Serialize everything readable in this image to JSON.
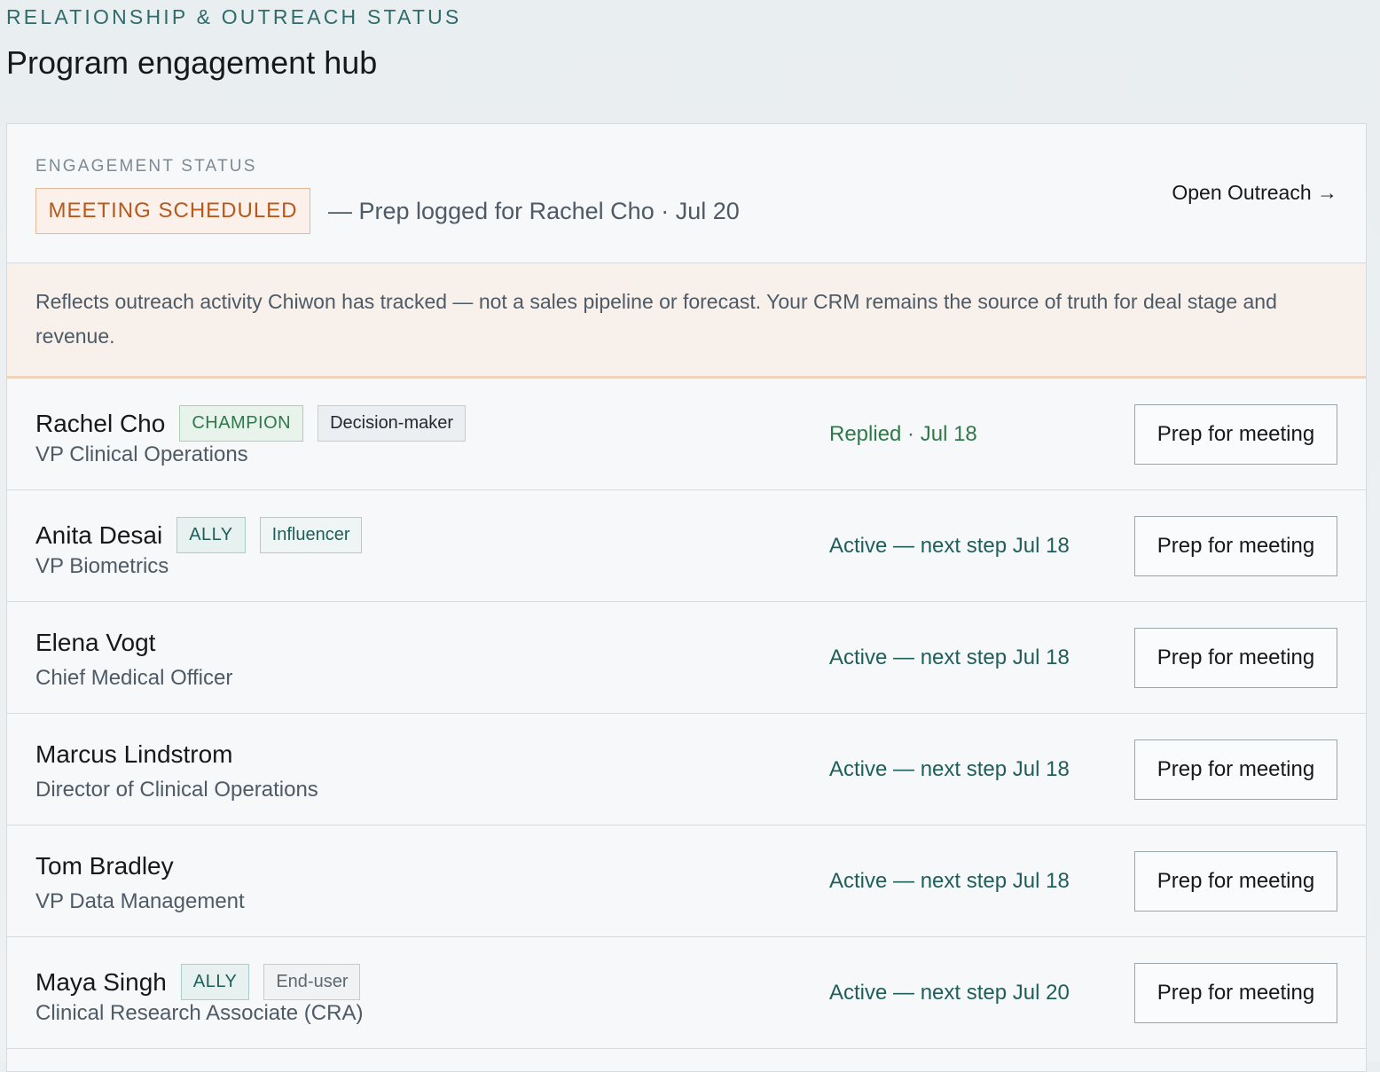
{
  "header": {
    "eyebrow": "RELATIONSHIP & OUTREACH STATUS",
    "title": "Program engagement hub"
  },
  "engagement": {
    "label": "ENGAGEMENT STATUS",
    "badge": "MEETING SCHEDULED",
    "detail": "— Prep logged for Rachel Cho · Jul 20",
    "open_link": "Open Outreach →"
  },
  "notice": "Reflects outreach activity Chiwon has tracked — not a sales pipeline or forecast. Your CRM remains the source of truth for deal stage and revenue.",
  "contacts": [
    {
      "name": "Rachel Cho",
      "tags": [
        {
          "label": "CHAMPION",
          "kind": "champion"
        },
        {
          "label": "Decision-maker",
          "kind": "role"
        }
      ],
      "title": "VP Clinical Operations",
      "status": "Replied · Jul 18",
      "status_kind": "replied",
      "action": "Prep for meeting"
    },
    {
      "name": "Anita Desai",
      "tags": [
        {
          "label": "ALLY",
          "kind": "ally"
        },
        {
          "label": "Influencer",
          "kind": "influencer"
        }
      ],
      "title": "VP Biometrics",
      "status": "Active — next step Jul 18",
      "status_kind": "active",
      "action": "Prep for meeting"
    },
    {
      "name": "Elena Vogt",
      "tags": [],
      "title": "Chief Medical Officer",
      "status": "Active — next step Jul 18",
      "status_kind": "active",
      "action": "Prep for meeting"
    },
    {
      "name": "Marcus Lindstrom",
      "tags": [],
      "title": "Director of Clinical Operations",
      "status": "Active — next step Jul 18",
      "status_kind": "active",
      "action": "Prep for meeting"
    },
    {
      "name": "Tom Bradley",
      "tags": [],
      "title": "VP Data Management",
      "status": "Active — next step Jul 18",
      "status_kind": "active",
      "action": "Prep for meeting"
    },
    {
      "name": "Maya Singh",
      "tags": [
        {
          "label": "ALLY",
          "kind": "ally"
        },
        {
          "label": "End-user",
          "kind": "enduser"
        }
      ],
      "title": "Clinical Research Associate (CRA)",
      "status": "Active — next step Jul 20",
      "status_kind": "active",
      "action": "Prep for meeting"
    }
  ]
}
